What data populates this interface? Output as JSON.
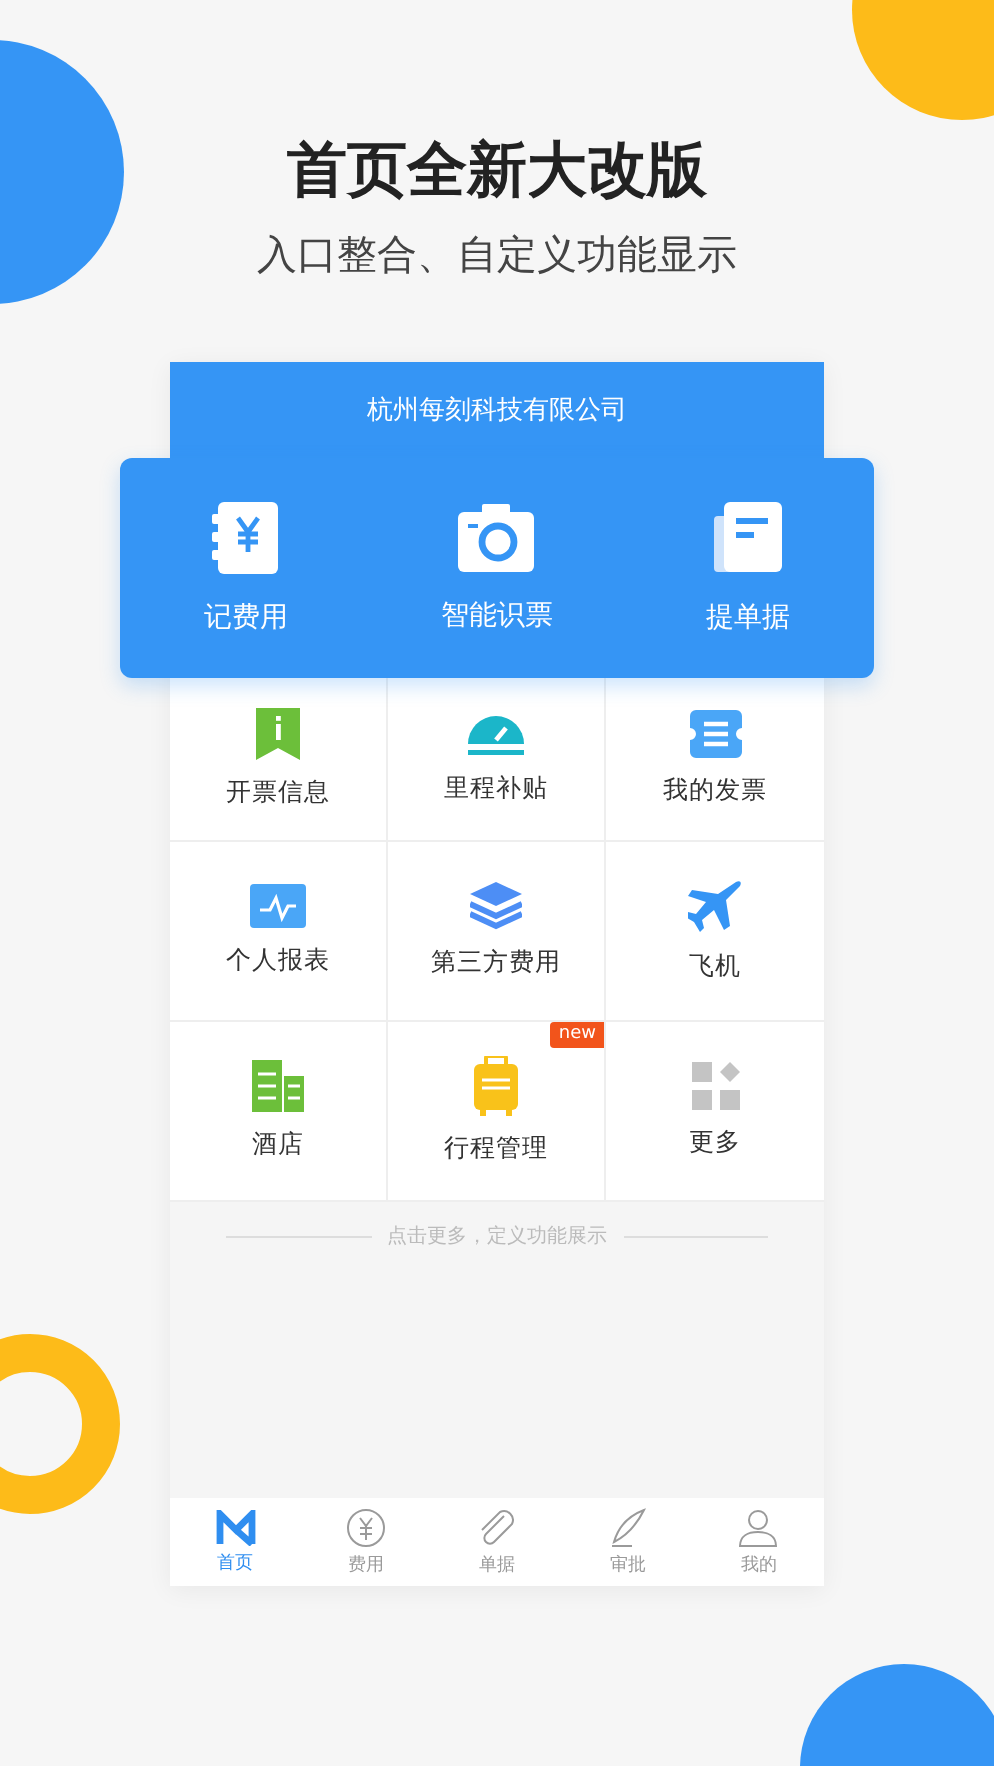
{
  "headline": {
    "title": "首页全新大改版",
    "subtitle": "入口整合、自定义功能显示"
  },
  "company": "杭州每刻科技有限公司",
  "shortcuts": [
    {
      "label": "记费用"
    },
    {
      "label": "智能识票"
    },
    {
      "label": "提单据"
    }
  ],
  "tiles": [
    {
      "label": "开票信息"
    },
    {
      "label": "里程补贴"
    },
    {
      "label": "我的发票"
    },
    {
      "label": "个人报表"
    },
    {
      "label": "第三方费用"
    },
    {
      "label": "飞机"
    },
    {
      "label": "酒店"
    },
    {
      "label": "行程管理",
      "badge": "new"
    },
    {
      "label": "更多"
    }
  ],
  "hint": "点击更多，定义功能展示",
  "tabs": [
    {
      "label": "首页",
      "selected": true
    },
    {
      "label": "费用",
      "selected": false
    },
    {
      "label": "单据",
      "selected": false
    },
    {
      "label": "审批",
      "selected": false
    },
    {
      "label": "我的",
      "selected": false
    }
  ]
}
